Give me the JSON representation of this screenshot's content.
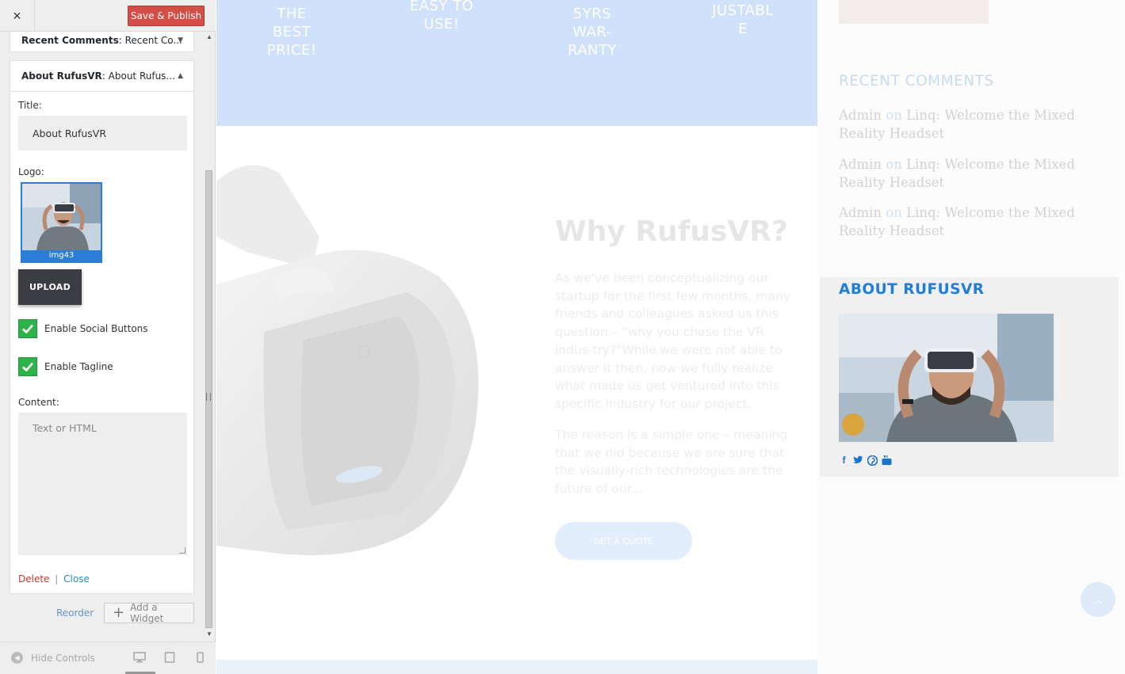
{
  "customizer": {
    "close_icon": "×",
    "save_label": "Save & Publish",
    "widgets": {
      "recent_comments": {
        "bold": "Recent Comments",
        "rest": ": Recent Co..."
      },
      "about": {
        "bold": "About RufusVR",
        "rest": ": About Rufus...",
        "title_label": "Title:",
        "title_value": "About RufusVR",
        "logo_label": "Logo:",
        "logo_name": "img43",
        "upload_label": "UPLOAD",
        "social_label": "Enable Social Buttons",
        "tagline_label": "Enable Tagline",
        "content_label": "Content:",
        "content_placeholder": "Text or HTML",
        "delete_label": "Delete",
        "separator": "|",
        "close_label": "Close"
      }
    },
    "reorder_label": "Reorder",
    "add_widget_label": "Add a Widget",
    "hide_controls_label": "Hide Controls"
  },
  "preview": {
    "features": [
      {
        "text": "THE\nBEST\nPRICE!"
      },
      {
        "text": "EASY TO\nUSE!"
      },
      {
        "text": "5YRS\nWAR-\nRANTY"
      },
      {
        "text": "JUSTABL\nE"
      }
    ],
    "why": {
      "title": "Why RufusVR?",
      "p1": "As we've been conceptualizing our startup for the first few months, many friends and colleagues asked us this question – \"why you chose the VR indus-try?\"While we were not able to answer it then, now we fully realize what made us get ventured into this specific industry for our project.",
      "p2": "The reason is a simple one – meaning that we did because we are sure that the visually-rich technologies are the future of our...",
      "button": "GET A QUOTE"
    },
    "recent_comments": {
      "heading": "RECENT COMMENTS",
      "items": [
        {
          "author": "Admin",
          "on": "on",
          "post": "Linq: Welcome the Mixed Reality Headset"
        },
        {
          "author": "Admin",
          "on": "on",
          "post": "Linq: Welcome the Mixed Reality Headset"
        },
        {
          "author": "Admin",
          "on": "on",
          "post": "Linq: Welcome the Mixed Reality Headset"
        }
      ]
    },
    "about": {
      "heading": "ABOUT RUFUSVR",
      "social": [
        "f",
        "t",
        "p",
        "You"
      ]
    }
  }
}
